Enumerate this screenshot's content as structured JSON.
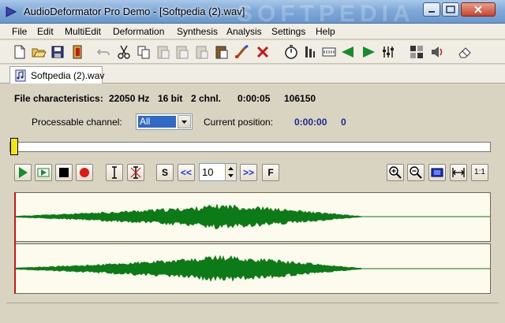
{
  "window": {
    "title": "AudioDeformator Pro Demo - [Softpedia (2).wav]",
    "watermark": "SOFTPEDIA"
  },
  "menu": [
    "File",
    "Edit",
    "MultiEdit",
    "Deformation",
    "Synthesis",
    "Analysis",
    "Settings",
    "Help"
  ],
  "toolbar": {
    "icons": [
      "new-file-icon",
      "open-folder-icon",
      "save-icon",
      "close-document-icon",
      "undo-icon",
      "cut-icon",
      "copy-icon",
      "paste-icon",
      "paste-special-icon",
      "paste-mix-icon",
      "clipboard-icon",
      "brush-icon",
      "delete-icon",
      "stopwatch-icon",
      "levels-icon",
      "filter-icon",
      "fade-in-icon",
      "fade-out-icon",
      "equalizer-icon",
      "grid-icon",
      "speaker-icon",
      "eraser-icon"
    ]
  },
  "tab": {
    "label": "Softpedia (2).wav"
  },
  "file_info": {
    "label": "File characteristics:",
    "sample_rate": "22050 Hz",
    "bits": "16 bit",
    "channels": "2 chnl.",
    "duration": "0:00:05",
    "samples": "106150"
  },
  "channel": {
    "label": "Processable channel:",
    "selected": "All"
  },
  "position": {
    "label": "Current position:",
    "time": "0:00:00",
    "sample": "0"
  },
  "transport": {
    "s_label": "S",
    "rewind_label": "<<",
    "step_value": "10",
    "forward_label": ">>",
    "f_label": "F",
    "zoom_ratio_label": "1:1"
  },
  "colors": {
    "waveform": "#0c7a16",
    "wave_bg": "#fdfbee",
    "cursor": "#c81818"
  }
}
